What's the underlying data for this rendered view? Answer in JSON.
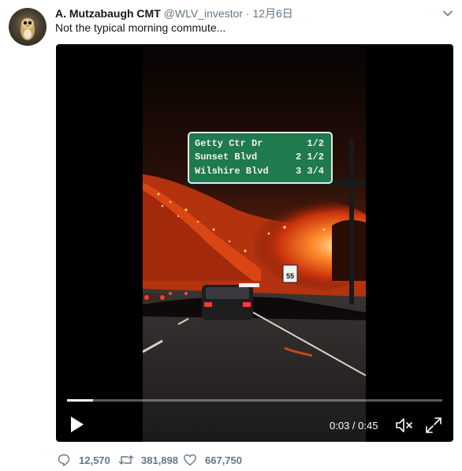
{
  "tweet": {
    "author_name": "A. Mutzabaugh CMT",
    "handle": "@WLV_investor",
    "separator": "·",
    "date": "12月6日",
    "text": "Not the typical morning commute..."
  },
  "video": {
    "current_time": "0:03",
    "duration": "0:45",
    "time_separator": " / ",
    "progress_fraction": 0.07,
    "sign": {
      "rows": [
        {
          "place": "Getty Ctr Dr",
          "distance": "1/2"
        },
        {
          "place": "Sunset Blvd",
          "distance": "2 1/2"
        },
        {
          "place": "Wilshire Blvd",
          "distance": "3 3/4"
        }
      ],
      "speed_sign": "55",
      "color": "#1f7a4d"
    }
  },
  "actions": {
    "replies": "12,570",
    "retweets": "381,898",
    "likes": "667,750"
  },
  "icons": {
    "caret": "chevron-down-icon",
    "reply": "reply-icon",
    "retweet": "retweet-icon",
    "like": "heart-icon",
    "play": "play-icon",
    "mute": "muted-speaker-icon",
    "fullscreen": "expand-icon"
  },
  "colors": {
    "secondary_text": "#657786",
    "primary_text": "#14171a"
  }
}
